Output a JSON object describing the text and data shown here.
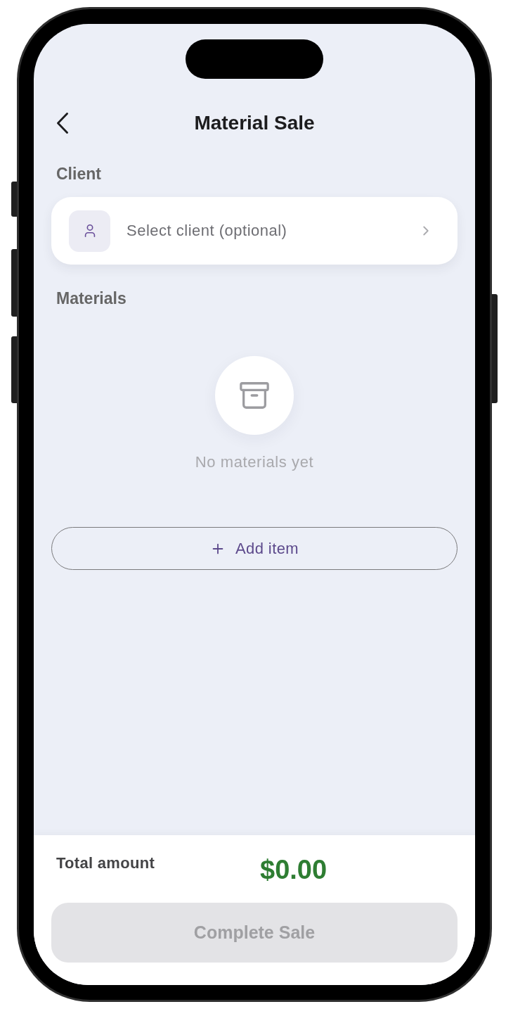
{
  "header": {
    "title": "Material Sale"
  },
  "client_section": {
    "label": "Client",
    "picker": {
      "placeholder": "Select client (optional)"
    }
  },
  "materials_section": {
    "label": "Materials",
    "empty_state": {
      "message": "No materials yet"
    },
    "add_button": {
      "label": "Add item"
    }
  },
  "footer": {
    "total_label": "Total amount",
    "total_value": "$0.00",
    "complete_button": {
      "label": "Complete Sale",
      "disabled": true
    }
  }
}
